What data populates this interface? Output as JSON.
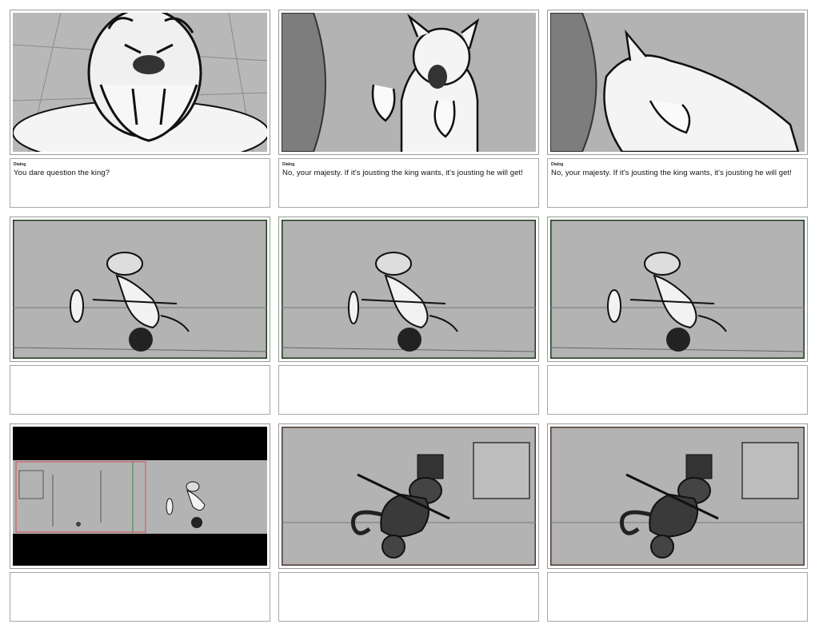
{
  "storyboard": {
    "panels": [
      {
        "scene": "bulldog-king-closeup",
        "dialog_label": "Dialog",
        "dialog": "You dare question the king?"
      },
      {
        "scene": "cat-surprised-hands-up",
        "dialog_label": "Dialog",
        "dialog": "No, your majesty. If it's jousting the king wants, it's jousting he will get!"
      },
      {
        "scene": "cat-bowing",
        "dialog_label": "Dialog",
        "dialog": "No, your majesty. If it's jousting the king wants, it's jousting he will get!"
      },
      {
        "scene": "knight-on-ball-1",
        "dialog_label": "",
        "dialog": ""
      },
      {
        "scene": "knight-on-ball-2",
        "dialog_label": "",
        "dialog": ""
      },
      {
        "scene": "knight-on-ball-3",
        "dialog_label": "",
        "dialog": ""
      },
      {
        "scene": "wide-shot-letterbox",
        "dialog_label": "",
        "dialog": ""
      },
      {
        "scene": "dark-cat-on-ball-1",
        "dialog_label": "",
        "dialog": ""
      },
      {
        "scene": "dark-cat-on-ball-2",
        "dialog_label": "",
        "dialog": ""
      }
    ]
  },
  "colors": {
    "sketch_bg": "#b3b3b3",
    "ink": "#111111",
    "letterbox": "#000000"
  }
}
